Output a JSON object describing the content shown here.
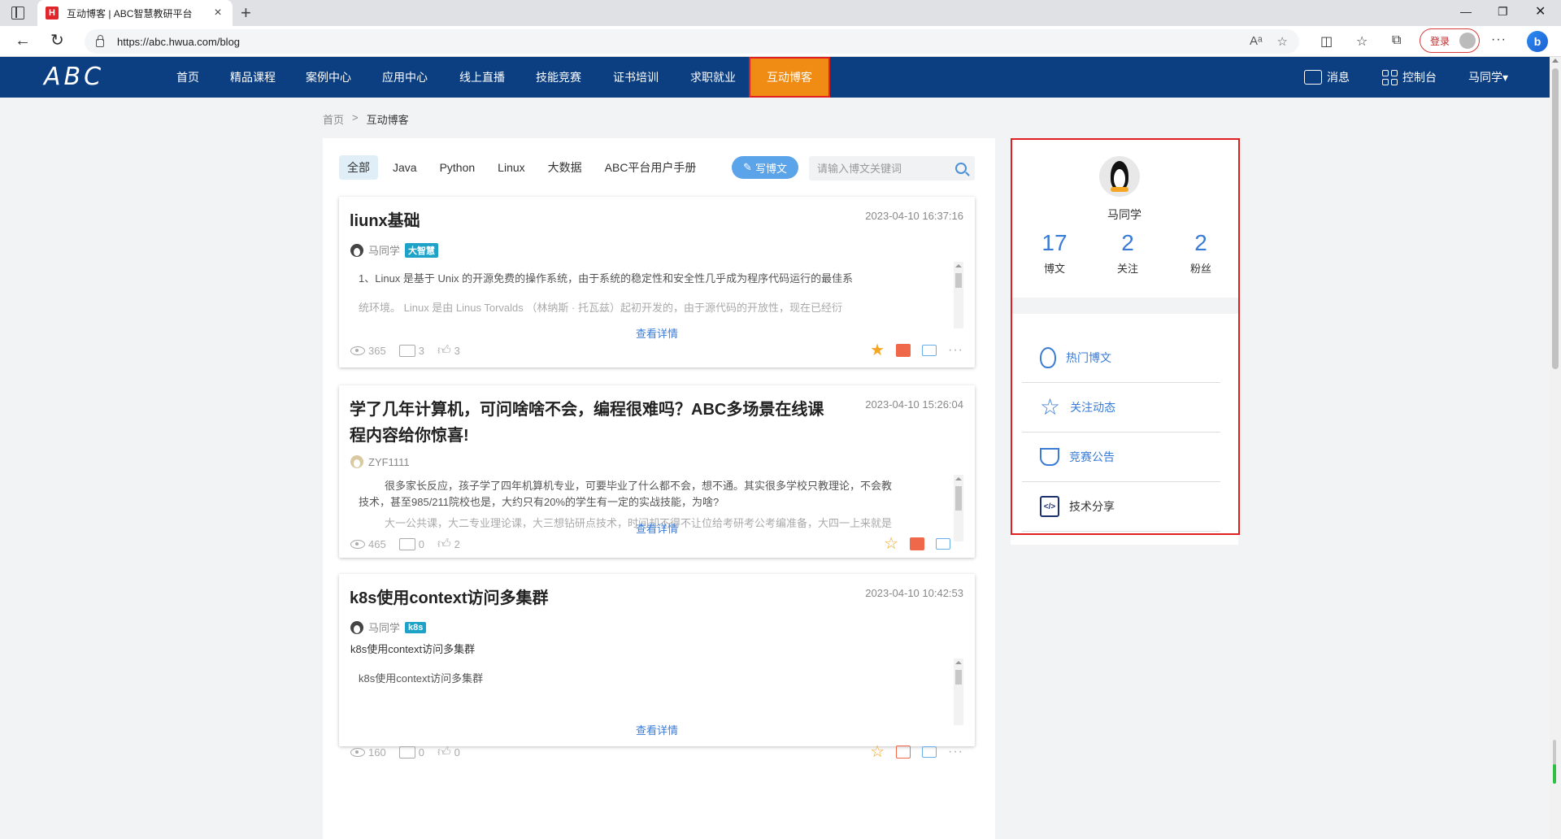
{
  "browser": {
    "tab_title": "互动博客 | ABC智慧教研平台",
    "tab_favicon": "H",
    "url": "https://abc.hwua.com/blog",
    "login_label": "登录"
  },
  "header": {
    "logo": "ABC",
    "nav": [
      "首页",
      "精品课程",
      "案例中心",
      "应用中心",
      "线上直播",
      "技能竞赛",
      "证书培训",
      "求职就业",
      "互动博客"
    ],
    "active_nav": "互动博客",
    "messages_label": "消息",
    "console_label": "控制台",
    "user_label": "马同学▾"
  },
  "breadcrumb": {
    "home": "首页",
    "sep": ">",
    "current": "互动博客"
  },
  "filters": {
    "items": [
      "全部",
      "Java",
      "Python",
      "Linux",
      "大数据",
      "ABC平台用户手册"
    ],
    "active": "全部",
    "write_label": "写博文",
    "search_placeholder": "请输入博文关键词"
  },
  "posts": [
    {
      "title": "liunx基础",
      "date": "2023-04-10 16:37:16",
      "author": "马同学",
      "tag": "大智慧",
      "excerpt_1": "1、Linux 是基于 Unix 的开源免费的操作系统，由于系统的稳定性和安全性几乎成为程序代码运行的最佳系",
      "excerpt_2": "统环境。 Linux 是由 Linus Torvalds （林纳斯 · 托瓦兹）起初开发的，由于源代码的开放性，现在已经衍",
      "view_detail": "查看详情",
      "views": "365",
      "comments": "3",
      "likes": "3"
    },
    {
      "title": "学了几年计算机，可问啥啥不会，编程很难吗？ABC多场景在线课程内容给你惊喜!",
      "date": "2023-04-10 15:26:04",
      "author": "ZYF1111",
      "excerpt_1": "很多家长反应，孩子学了四年机算机专业，可要毕业了什么都不会，想不通。其实很多学校只教理论，不会教",
      "excerpt_2": "技术，甚至985/211院校也是，大约只有20%的学生有一定的实战技能，为啥?",
      "excerpt_3": "大一公共课，大二专业理论课，大三想钻研点技术，时间却不得不让位给考研考公考编准备，大四一上来就是",
      "view_detail": "查看详情",
      "views": "465",
      "comments": "0",
      "likes": "2"
    },
    {
      "title": "k8s使用context访问多集群",
      "date": "2023-04-10 10:42:53",
      "author": "马同学",
      "tag": "k8s",
      "summary": "k8s使用context访问多集群",
      "excerpt_1": "k8s使用context访问多集群",
      "view_detail": "查看详情",
      "views": "160",
      "comments": "0",
      "likes": "0"
    }
  ],
  "profile": {
    "name": "马同学",
    "stats": [
      {
        "value": "17",
        "label": "博文"
      },
      {
        "value": "2",
        "label": "关注"
      },
      {
        "value": "2",
        "label": "粉丝"
      }
    ]
  },
  "side_menu": [
    {
      "label": "热门博文",
      "icon": "flame-icon"
    },
    {
      "label": "关注动态",
      "icon": "star-icon"
    },
    {
      "label": "竞赛公告",
      "icon": "trophy-icon"
    },
    {
      "label": "技术分享",
      "icon": "code-icon"
    }
  ],
  "colors": {
    "header_bg": "#0b3f82",
    "active_nav_bg": "#f08b14",
    "accent_blue": "#3a7bd5",
    "highlight_red": "#e02020"
  }
}
